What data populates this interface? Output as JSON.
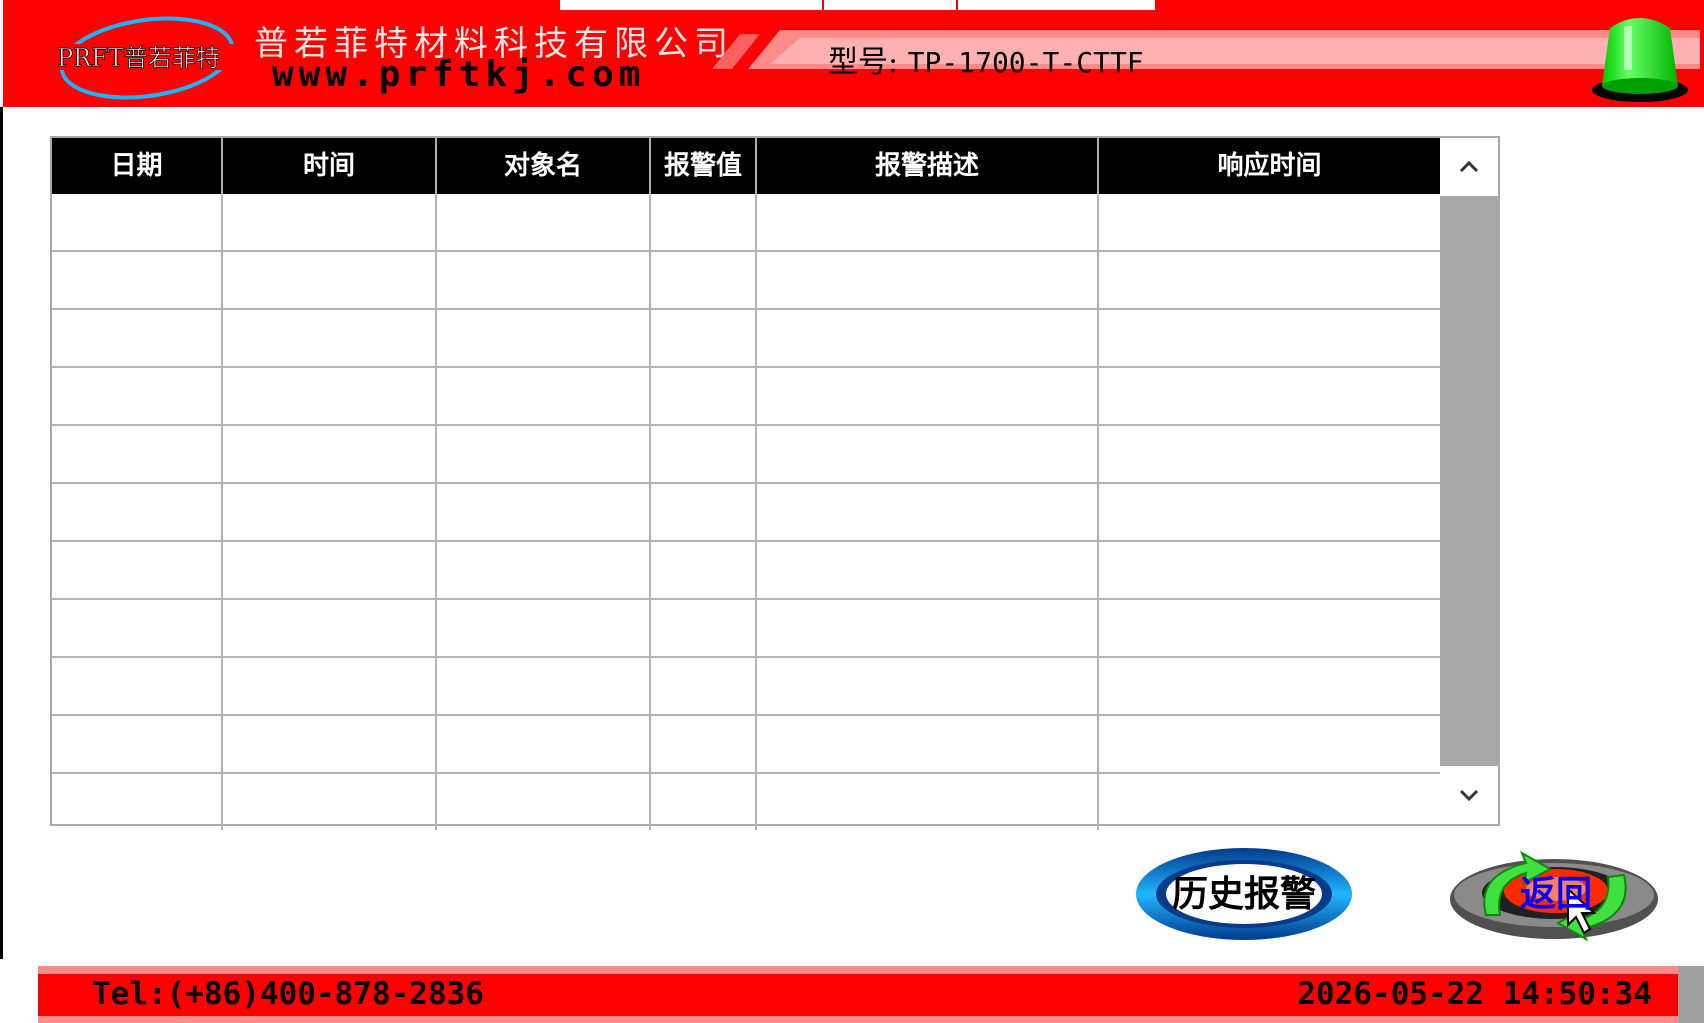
{
  "header": {
    "logo_text": "PRFT普若菲特",
    "company_name": "普若菲特材料科技有限公司",
    "website": "www.prftkj.com",
    "model_label": "型号:",
    "model_value": "TP-1700-T-CTTF",
    "status_lamp_color": "#00ff00",
    "brand_color": "#ff0000"
  },
  "alarm_table": {
    "columns": [
      "日期",
      "时间",
      "对象名",
      "报警值",
      "报警描述",
      "响应时间"
    ],
    "row_count": 11,
    "rows": []
  },
  "buttons": {
    "history_label": "历史报警",
    "back_label": "返回"
  },
  "footer": {
    "tel": "Tel:(+86)400-878-2836",
    "datetime": "2026-05-22 14:50:34"
  }
}
